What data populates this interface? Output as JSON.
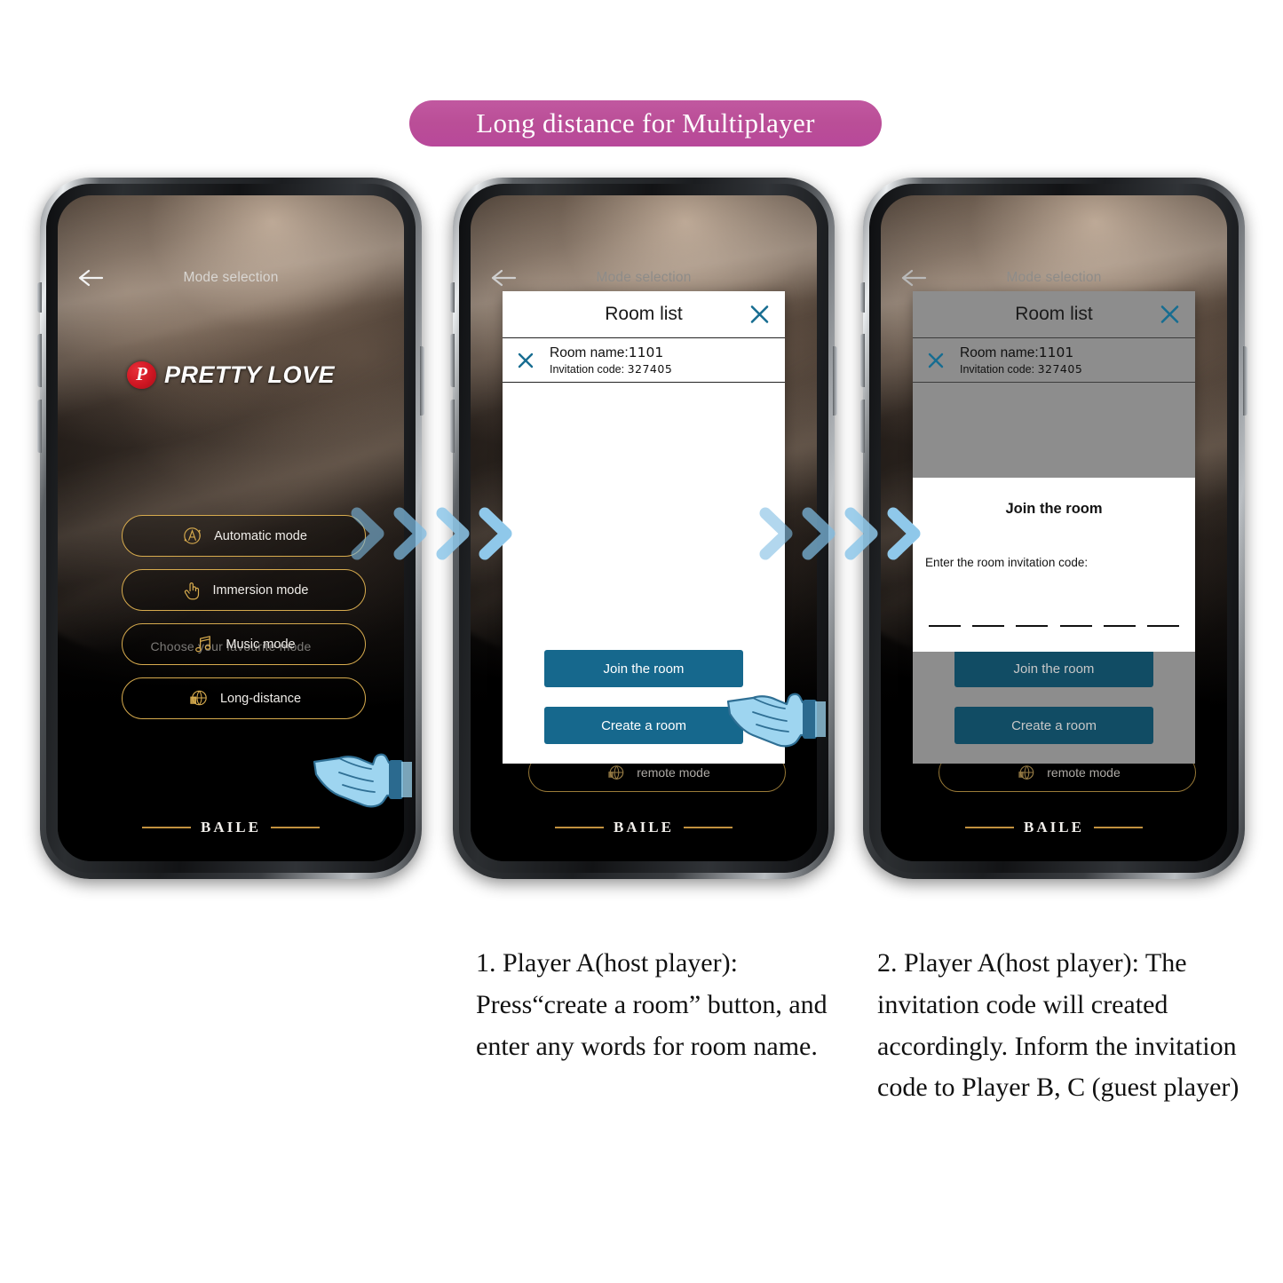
{
  "banner": {
    "title": "Long distance for Multiplayer",
    "color": "#ba4e97"
  },
  "phones": [
    {
      "id": "phone-mode-selection",
      "nav": {
        "title": "Mode selection",
        "back_icon": "arrow-left-icon"
      },
      "logo": {
        "badge_letter": "P",
        "word1": "PRETTY",
        "word2": "LOVE",
        "badge_color": "#cf1622"
      },
      "subtitle": "Choose your favourite mode",
      "modes": [
        {
          "label": "Automatic mode",
          "icon": "automatic-a-circle-icon"
        },
        {
          "label": "Immersion mode",
          "icon": "pointing-hand-icon"
        },
        {
          "label": "Music mode",
          "icon": "music-note-icon"
        },
        {
          "label": "Long-distance",
          "icon": "globe-icon"
        }
      ],
      "footer": "BAILE"
    },
    {
      "id": "phone-room-list",
      "nav": {
        "title": "Mode selection",
        "back_icon": "arrow-left-icon"
      },
      "dialog": {
        "title": "Room list",
        "close_icon": "close-x-icon",
        "rows": [
          {
            "remove_icon": "close-x-icon",
            "name_label": "Room name:",
            "name_value": "1101",
            "code_label": "Invitation code:",
            "code_value": "327405"
          }
        ],
        "buttons": [
          {
            "label": "Join the room"
          },
          {
            "label": "Create a room"
          }
        ]
      },
      "remote_pill": {
        "label": "remote mode",
        "icon": "globe-icon"
      },
      "footer": "BAILE"
    },
    {
      "id": "phone-join-room",
      "nav": {
        "title": "Mode selection",
        "back_icon": "arrow-left-icon"
      },
      "dialog": {
        "title": "Room list",
        "close_icon": "close-x-icon",
        "rows": [
          {
            "remove_icon": "close-x-icon",
            "name_label": "Room name:",
            "name_value": "1101",
            "code_label": "Invitation code:",
            "code_value": "327405"
          }
        ],
        "buttons": [
          {
            "label": "Join the room"
          },
          {
            "label": "Create a room"
          }
        ]
      },
      "overlay": {
        "title": "Join the room",
        "prompt": "Enter the room invitation code:",
        "slots": 6
      },
      "remote_pill": {
        "label": "remote mode",
        "icon": "globe-icon"
      },
      "footer": "BAILE"
    }
  ],
  "arrows": {
    "icon": "chevron-right-icon",
    "count_per_group": 4,
    "color": "#7fbde4"
  },
  "cursor": {
    "icon": "pointing-hand-cursor-icon",
    "color": "#9ed5f0"
  },
  "captions": [
    "1. Player A(host player): Press“create a room” button, and enter any words for room name.",
    "2. Player A(host player): The invitation code will created accordingly. Inform the invitation code to Player B, C (guest player)"
  ]
}
